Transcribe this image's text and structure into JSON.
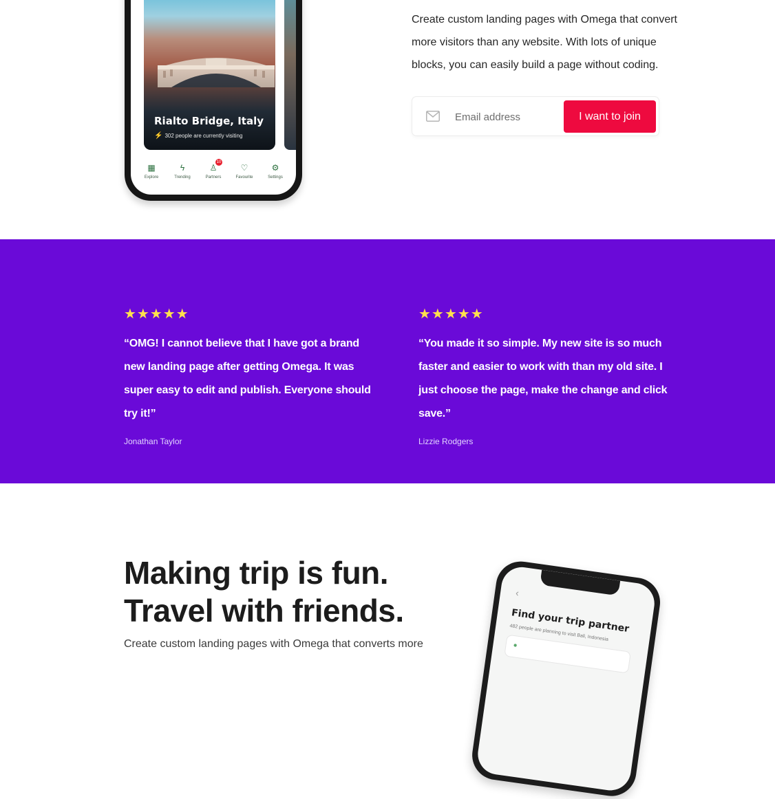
{
  "phone_preview": {
    "card_title": "Rialto Bridge, Italy",
    "card_subtitle": "302 people are currently visiting",
    "tabs": [
      {
        "label": "Explore",
        "icon": "building-icon"
      },
      {
        "label": "Trending",
        "icon": "bolt-icon"
      },
      {
        "label": "Partners",
        "icon": "users-icon",
        "badge": "10"
      },
      {
        "label": "Favourite",
        "icon": "heart-icon"
      },
      {
        "label": "Settings",
        "icon": "gear-icon"
      }
    ]
  },
  "signup": {
    "intro": "Create custom landing pages with Omega that convert more visitors than any website. With lots of unique blocks, you can easily build a page without coding.",
    "email_placeholder": "Email address",
    "button_label": "I want to join"
  },
  "testimonials": [
    {
      "rating": 5,
      "stars": "★★★★★",
      "quote": "“OMG! I cannot believe that I have got a brand new landing page after getting Omega. It was super easy to edit and publish. Everyone should try it!”",
      "author": "Jonathan Taylor"
    },
    {
      "rating": 5,
      "stars": "★★★★★",
      "quote": "“You made it so simple. My new site is so much faster and easier to work with than my old site. I just choose the page, make the change and click save.”",
      "author": "Lizzie Rodgers"
    }
  ],
  "trip_section": {
    "headline_line1": "Making trip is fun.",
    "headline_line2": "Travel with friends.",
    "body_partial": "Create custom landing pages with Omega that converts more",
    "phone_title": "Find your trip partner",
    "phone_subtitle": "482 people are planning to visit Bali, Indonesia"
  },
  "colors": {
    "accent_button": "#ee0a3f",
    "testimonial_band": "#6a0ad8",
    "star": "#ffe14d"
  }
}
